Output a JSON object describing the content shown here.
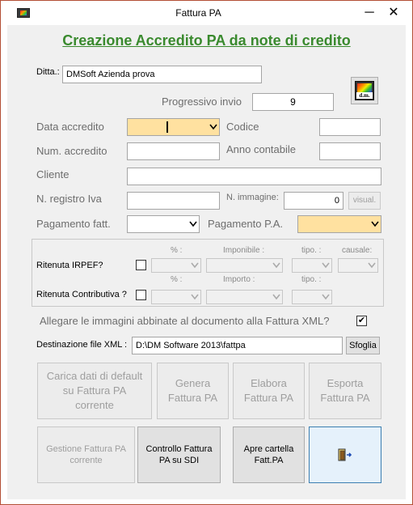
{
  "window": {
    "title": "Fattura PA",
    "minimize_glyph": "─",
    "close_glyph": "✕",
    "icon": "dm-app-icon"
  },
  "heading": "Creazione Accredito PA da note di credito",
  "ditta": {
    "label": "Ditta.:",
    "value": "DMSoft Azienda prova"
  },
  "progressivo": {
    "label": "Progressivo invio",
    "value": "9"
  },
  "data_accredito": {
    "label": "Data accredito",
    "value": ""
  },
  "codice": {
    "label": "Codice",
    "value": ""
  },
  "num_accredito": {
    "label": "Num. accredito",
    "value": ""
  },
  "anno_contabile": {
    "label": "Anno contabile",
    "value": ""
  },
  "cliente": {
    "label": "Cliente",
    "value": ""
  },
  "registro_iva": {
    "label": "N. registro Iva",
    "value": ""
  },
  "immagine": {
    "label": "N. immagine:",
    "value": "0",
    "visual_button": "visual."
  },
  "pagamento_fatt": {
    "label": "Pagamento fatt.",
    "value": ""
  },
  "pagamento_pa": {
    "label": "Pagamento P.A.",
    "value": ""
  },
  "ritenute": {
    "irpef_label": "Ritenuta  IRPEF?",
    "contributiva_label": "Ritenuta Contributiva ?",
    "col_percent": "% :",
    "col_imponibile": "Imponibile :",
    "col_tipo": "tipo. :",
    "col_causale": "causale:",
    "col_importo": "Importo :"
  },
  "allegare": {
    "label": "Allegare le immagini abbinate al documento alla Fattura XML?",
    "checked": true,
    "check_glyph": "✔"
  },
  "destinazione": {
    "label": "Destinazione file XML :",
    "value": "D:\\DM Software 2013\\fattpa",
    "browse_label": "Sfoglia"
  },
  "buttons": {
    "carica": "Carica dati di default su  Fattura PA corrente",
    "genera": "Genera Fattura PA",
    "elabora": "Elabora Fattura PA",
    "esporta": "Esporta Fattura PA",
    "gestione": "Gestione Fattura PA corrente",
    "controllo": "Controllo Fattura PA su SDI",
    "apre": "Apre cartella Fatt.PA",
    "exit_icon": "exit-door-icon"
  }
}
